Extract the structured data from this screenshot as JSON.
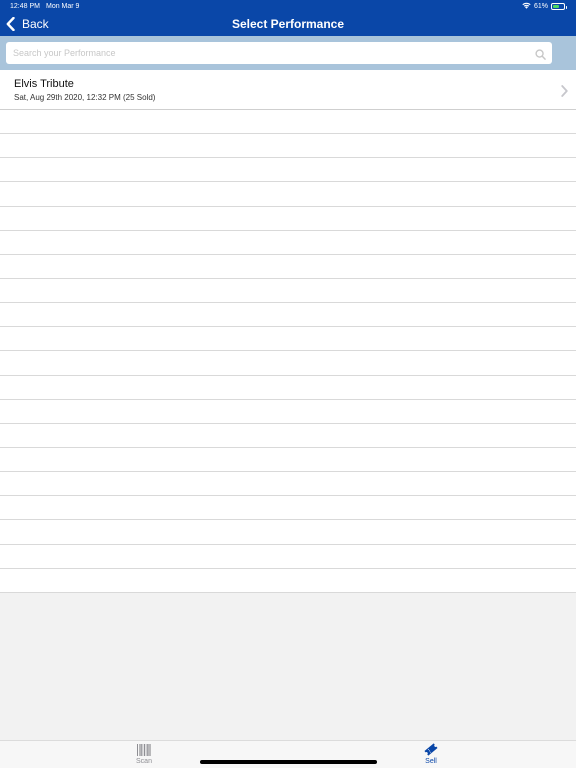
{
  "status_bar": {
    "time": "12:48 PM",
    "date": "Mon Mar 9",
    "battery": "61%",
    "battery_level": 0.61,
    "wifi_icon": "wifi-icon",
    "battery_icon": "battery-icon"
  },
  "nav": {
    "back_label": "Back",
    "back_icon": "chevron-left-icon",
    "title": "Select Performance"
  },
  "search": {
    "placeholder": "Search your Performance",
    "value": "",
    "icon": "search-icon"
  },
  "performances": [
    {
      "title": "Elvis Tribute",
      "subtitle": "Sat, Aug 29th 2020, 12:32 PM (25 Sold)",
      "icon": "chevron-right-icon"
    }
  ],
  "tabs": [
    {
      "label": "Scan",
      "icon": "barcode-icon",
      "active": false
    },
    {
      "label": "Sell",
      "icon": "ticket-icon",
      "active": true
    }
  ],
  "colors": {
    "header": "#0a47a8",
    "search_bar": "#a9c4db",
    "active_tab": "#0a47a8",
    "inactive_tab": "#8e8e93",
    "battery": "#4cd964"
  }
}
